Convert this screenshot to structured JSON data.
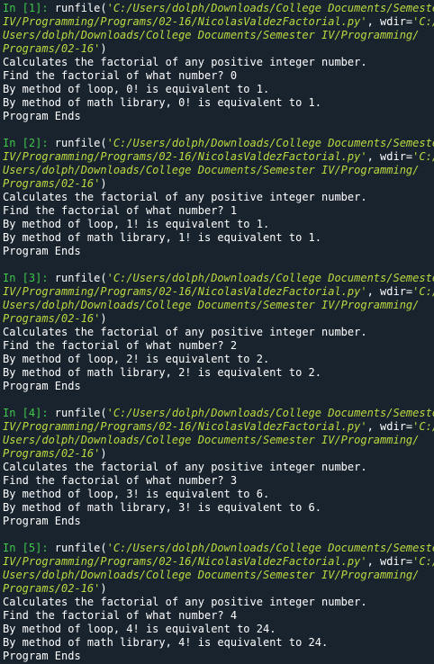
{
  "console": {
    "cells": [
      {
        "prompt": "In [1]: ",
        "lines": [
          [
            "runfile(",
            "'C:/Users/dolph/Downloads/College Documents/Semester"
          ],
          [
            "",
            "IV/Programming/Programs/02-16/NicolasValdezFactorial.py'",
            ", wdir=",
            "'C:/"
          ],
          [
            "",
            "Users/dolph/Downloads/College Documents/Semester IV/Programming/"
          ],
          [
            "",
            "Programs/02-16'",
            ")"
          ]
        ],
        "output": [
          "Calculates the factorial of any positive integer number.",
          "Find the factorial of what number? 0",
          "By method of loop, 0! is equivalent to 1.",
          "By method of math library, 0! is equivalent to 1.",
          "Program Ends"
        ]
      },
      {
        "prompt": "In [2]: ",
        "lines": [
          [
            "runfile(",
            "'C:/Users/dolph/Downloads/College Documents/Semester"
          ],
          [
            "",
            "IV/Programming/Programs/02-16/NicolasValdezFactorial.py'",
            ", wdir=",
            "'C:/"
          ],
          [
            "",
            "Users/dolph/Downloads/College Documents/Semester IV/Programming/"
          ],
          [
            "",
            "Programs/02-16'",
            ")"
          ]
        ],
        "output": [
          "Calculates the factorial of any positive integer number.",
          "Find the factorial of what number? 1",
          "By method of loop, 1! is equivalent to 1.",
          "By method of math library, 1! is equivalent to 1.",
          "Program Ends"
        ]
      },
      {
        "prompt": "In [3]: ",
        "lines": [
          [
            "runfile(",
            "'C:/Users/dolph/Downloads/College Documents/Semester"
          ],
          [
            "",
            "IV/Programming/Programs/02-16/NicolasValdezFactorial.py'",
            ", wdir=",
            "'C:/"
          ],
          [
            "",
            "Users/dolph/Downloads/College Documents/Semester IV/Programming/"
          ],
          [
            "",
            "Programs/02-16'",
            ")"
          ]
        ],
        "output": [
          "Calculates the factorial of any positive integer number.",
          "Find the factorial of what number? 2",
          "By method of loop, 2! is equivalent to 2.",
          "By method of math library, 2! is equivalent to 2.",
          "Program Ends"
        ]
      },
      {
        "prompt": "In [4]: ",
        "lines": [
          [
            "runfile(",
            "'C:/Users/dolph/Downloads/College Documents/Semester"
          ],
          [
            "",
            "IV/Programming/Programs/02-16/NicolasValdezFactorial.py'",
            ", wdir=",
            "'C:/"
          ],
          [
            "",
            "Users/dolph/Downloads/College Documents/Semester IV/Programming/"
          ],
          [
            "",
            "Programs/02-16'",
            ")"
          ]
        ],
        "output": [
          "Calculates the factorial of any positive integer number.",
          "Find the factorial of what number? 3",
          "By method of loop, 3! is equivalent to 6.",
          "By method of math library, 3! is equivalent to 6.",
          "Program Ends"
        ]
      },
      {
        "prompt": "In [5]: ",
        "lines": [
          [
            "runfile(",
            "'C:/Users/dolph/Downloads/College Documents/Semester"
          ],
          [
            "",
            "IV/Programming/Programs/02-16/NicolasValdezFactorial.py'",
            ", wdir=",
            "'C:/"
          ],
          [
            "",
            "Users/dolph/Downloads/College Documents/Semester IV/Programming/"
          ],
          [
            "",
            "Programs/02-16'",
            ")"
          ]
        ],
        "output": [
          "Calculates the factorial of any positive integer number.",
          "Find the factorial of what number? 4",
          "By method of loop, 4! is equivalent to 24.",
          "By method of math library, 4! is equivalent to 24.",
          "Program Ends"
        ]
      }
    ]
  },
  "colors": {
    "background": "#19232d",
    "prompt": "#3fc84a",
    "string": "#bcd941",
    "text": "#ffffff"
  }
}
